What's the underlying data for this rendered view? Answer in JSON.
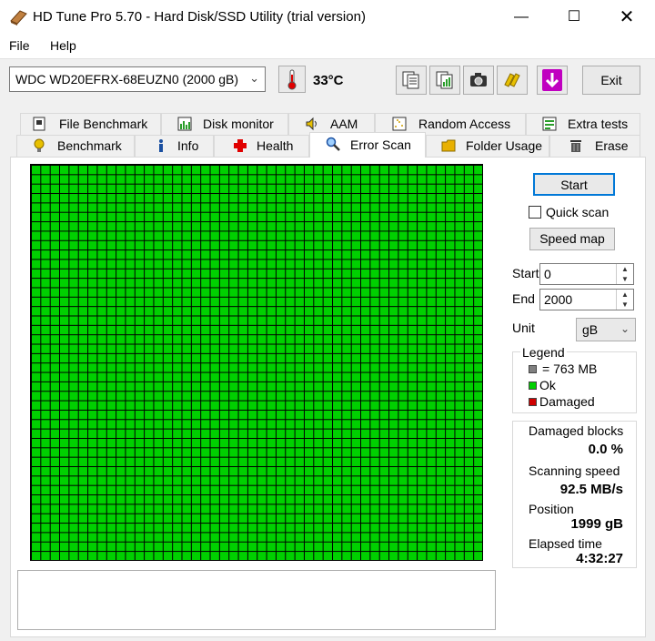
{
  "window": {
    "title": "HD Tune Pro 5.70 - Hard Disk/SSD Utility (trial version)"
  },
  "menu": {
    "file": "File",
    "help": "Help"
  },
  "toolbar": {
    "drive": "WDC WD20EFRX-68EUZN0 (2000 gB)",
    "temperature": "33°C",
    "exit_label": "Exit"
  },
  "tabs_top": [
    {
      "label": "File Benchmark"
    },
    {
      "label": "Disk monitor"
    },
    {
      "label": "AAM"
    },
    {
      "label": "Random Access"
    },
    {
      "label": "Extra tests"
    }
  ],
  "tabs_bottom": [
    {
      "label": "Benchmark"
    },
    {
      "label": "Info"
    },
    {
      "label": "Health"
    },
    {
      "label": "Error Scan",
      "active": true
    },
    {
      "label": "Folder Usage"
    },
    {
      "label": "Erase"
    }
  ],
  "scan": {
    "start_label": "Start",
    "quick_scan_label": "Quick scan",
    "quick_scan_checked": false,
    "speed_map_label": "Speed map",
    "start_field_label": "Start",
    "start_value": "0",
    "end_field_label": "End",
    "end_value": "2000",
    "unit_label": "Unit",
    "unit_value": "gB"
  },
  "legend": {
    "title": "Legend",
    "block_size": "= 763 MB",
    "ok": "Ok",
    "damaged": "Damaged",
    "colors": {
      "block": "#808080",
      "ok": "#00d000",
      "damaged": "#d00000"
    }
  },
  "stats": {
    "damaged_label": "Damaged blocks",
    "damaged_value": "0.0 %",
    "speed_label": "Scanning speed",
    "speed_value": "92.5 MB/s",
    "position_label": "Position",
    "position_value": "1999 gB",
    "elapsed_label": "Elapsed time",
    "elapsed_value": "4:32:27"
  }
}
